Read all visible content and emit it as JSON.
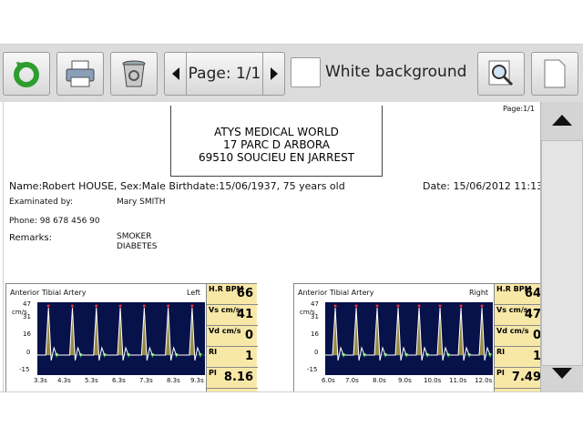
{
  "toolbar": {
    "refresh_icon": "refresh-icon",
    "print_icon": "printer-icon",
    "delete_icon": "trash-icon",
    "page_label": "Page: 1/1",
    "white_bg_label": "White background",
    "zoom_icon": "magnifier-icon",
    "blank_icon": "blank-page-icon"
  },
  "report": {
    "page_counter": "Page:1/1",
    "address": [
      "ATYS MEDICAL WORLD",
      "17 PARC D ARBORA",
      "69510 SOUCIEU EN JARREST"
    ],
    "patient_line": "Name:Robert HOUSE, Sex:Male Birthdate:15/06/1937, 75 years old",
    "date": "Date: 15/06/2012 11:13",
    "examined_label": "Examinated by:",
    "examined_value": "Mary SMITH",
    "phone": "Phone: 98 678 456 90",
    "remarks_label": "Remarks:",
    "remarks": [
      "SMOKER",
      "DIABETES"
    ]
  },
  "panels": [
    {
      "title": "Anterior Tibial Artery",
      "side": "Left",
      "y_unit": "cm/s",
      "y_ticks": [
        "47",
        "31",
        "16",
        "0",
        "-15"
      ],
      "x_ticks": [
        "3.3s",
        "4.3s",
        "5.3s",
        "6.3s",
        "7.3s",
        "8.3s",
        "9.3s"
      ],
      "metrics": [
        {
          "label": "H.R BPM",
          "value": "66"
        },
        {
          "label": "Vs cm/s",
          "value": "41"
        },
        {
          "label": "Vd cm/s",
          "value": "0"
        },
        {
          "label": "RI",
          "value": "1"
        },
        {
          "label": "PI",
          "value": "8.16"
        }
      ]
    },
    {
      "title": "Anterior Tibial Artery",
      "side": "Right",
      "y_unit": "cm/s",
      "y_ticks": [
        "47",
        "31",
        "16",
        "0",
        "-15"
      ],
      "x_ticks": [
        "6.0s",
        "7.0s",
        "8.0s",
        "9.0s",
        "10.0s",
        "11.0s",
        "12.0s"
      ],
      "metrics": [
        {
          "label": "H.R BPM",
          "value": "64"
        },
        {
          "label": "Vs cm/s",
          "value": "47"
        },
        {
          "label": "Vd cm/s",
          "value": "0"
        },
        {
          "label": "RI",
          "value": "1"
        },
        {
          "label": "PI",
          "value": "7.49"
        }
      ]
    }
  ],
  "colors": {
    "plot_bg": "#07124a",
    "metric_bg": "#f8e8a8",
    "accent_green": "#2e9d2e"
  }
}
